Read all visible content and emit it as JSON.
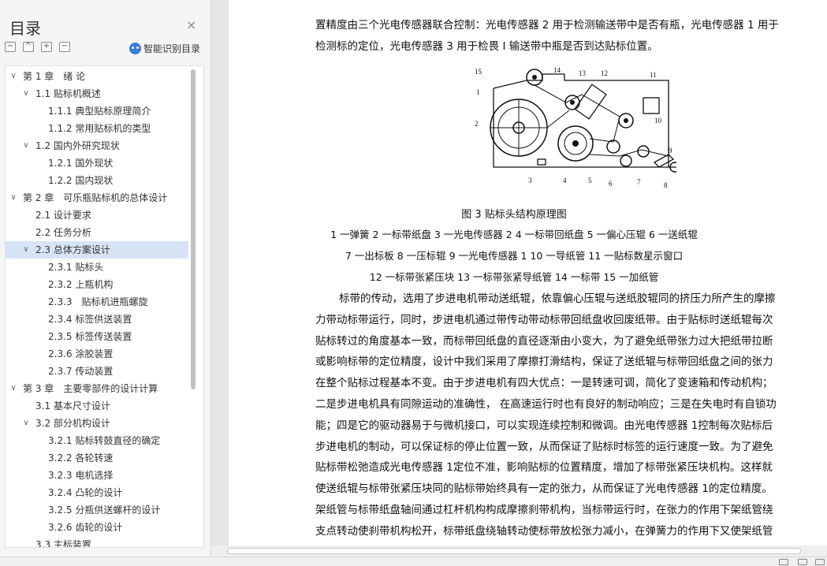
{
  "toc": {
    "title": "目录",
    "close_glyph": "×",
    "tools": [
      "−",
      "^",
      "+",
      "−"
    ],
    "smart_label": "智能识别目录",
    "items": [
      {
        "label": "第 1 章　绪 论",
        "level": 0,
        "expanded": true
      },
      {
        "label": "1.1  贴标机概述",
        "level": 1,
        "expanded": true
      },
      {
        "label": "1.1.1  典型贴标原理简介",
        "level": 2
      },
      {
        "label": "1.1.2  常用贴标机的类型",
        "level": 2
      },
      {
        "label": "1.2 国内外研究现状",
        "level": 1,
        "expanded": true
      },
      {
        "label": "1.2.1 国外现状",
        "level": 2
      },
      {
        "label": "1.2.2  国内现状",
        "level": 2
      },
      {
        "label": "第 2 章　可乐瓶贴标机的总体设计",
        "level": 0,
        "expanded": true
      },
      {
        "label": "2.1 设计要求",
        "level": 1
      },
      {
        "label": "2.2 任务分析",
        "level": 1
      },
      {
        "label": "2.3 总体方案设计",
        "level": 1,
        "expanded": true,
        "selected": true
      },
      {
        "label": "2.3.1  贴标头",
        "level": 2
      },
      {
        "label": "2.3.2  上瓶机构",
        "level": 2
      },
      {
        "label": "2.3.3　贴标机进瓶螺旋",
        "level": 2
      },
      {
        "label": "2.3.4 标签供送装置",
        "level": 2
      },
      {
        "label": "2.3.5 标签传送装置",
        "level": 2
      },
      {
        "label": "2.3.6 涂胶装置",
        "level": 2
      },
      {
        "label": "2.3.7 传动装置",
        "level": 2
      },
      {
        "label": "第 3 章　主要零部件的设计计算",
        "level": 0,
        "expanded": true
      },
      {
        "label": "3.1  基本尺寸设计",
        "level": 1
      },
      {
        "label": "3.2  部分机构设计",
        "level": 1,
        "expanded": true
      },
      {
        "label": "3.2.1 贴标转鼓直径的确定",
        "level": 2
      },
      {
        "label": "3.2.2 各轮转速",
        "level": 2
      },
      {
        "label": "3.2.3 电机选择",
        "level": 2
      },
      {
        "label": "3.2.4 凸轮的设计",
        "level": 2
      },
      {
        "label": "3.2.5 分瓶供送螺杆的设计",
        "level": 2
      },
      {
        "label": "3.2.6 齿轮的设计",
        "level": 2
      },
      {
        "label": "3.3 主标装置",
        "level": 1
      }
    ]
  },
  "document": {
    "top_lines": [
      "置精度由三个光电传感器联合控制：光电传感器 2 用于检测输送带中是否有瓶，光电传感器 1 用于",
      "检测标的定位，光电传感器 3 用于检畏 I 输送带中瓶是否到达贴标位置。"
    ],
    "figure_numbers": [
      "15",
      "1",
      "2",
      "14",
      "13",
      "12",
      "11",
      "10",
      "3",
      "4",
      "5",
      "6",
      "7",
      "8",
      "9"
    ],
    "caption": "图 3  贴标头结构原理图",
    "legend_lines": [
      "1 一弹簧  2 一标带纸盘  3 一光电传感器 2    4 一标带回纸盘  5 一偏心压辊  6 一送纸辊",
      "7 一出标板  8 一压标辊  9 一光电传感器 1    10 一导纸管    11 一贴标数星示窗口",
      "12 一标带张紧压块    13 一标带张紧导纸管  14 一标带         15 一加纸管"
    ],
    "body_lines": [
      "标带的传动，选用了步进电机带动送纸辊，依靠偏心压辊与送纸胶辊同的挤压力所产生的摩擦",
      "力带动标带运行，同时，步进电机通过带传动带动标带回纸盘收回废纸带。由于贴标时送纸辊每次",
      "贴标转过的角度基本一致，而标带回纸盘的直径逐渐由小变大，为了避免纸带张力过大把纸带拉断",
      "或影响标带的定位精度，设计中我们采用了摩擦打滑结构，保证了送纸辊与标带回纸盘之间的张力",
      "在整个贴标过程基本不变。由于步进电机有四大优点：一是转速可调，简化了变速箱和传动机构；",
      "二是步进电机具有同隙运动的准确性， 在高速运行时也有良好的制动响应；三是在失电时有自锁功",
      "能；四是它的驱动器易于与微机接口，可以实现连续控制和微调。由光电传感器 1控制每次贴标后",
      "步进电机的制动，可以保证标的停止位置一致，从而保证了贴标时标签的运行速度一致。为了避免",
      "贴标带松弛造成光电传感器 1定位不准，影响贴标的位置精度，增加了标带张紧压块机构。这样就",
      "使送纸辊与标带张紧压块同的贴标带始终具有一定的张力，从而保证了光电传感器 1的定位精度。",
      "架纸管与标带纸盘轴间通过杠杆机构构成摩擦刹带机构，当标带运行时，在张力的作用下架纸管绕",
      "支点转动使刹带机构松开，标带纸盘绕轴转动使标带放松张力减小，在弹簧力的作用下又使架纸管",
      "绕支点反向旋转将标带纸盘刹住，避免了标带纸盘在惯性力的作用下继续运转使标带过分松弛影响"
    ]
  }
}
